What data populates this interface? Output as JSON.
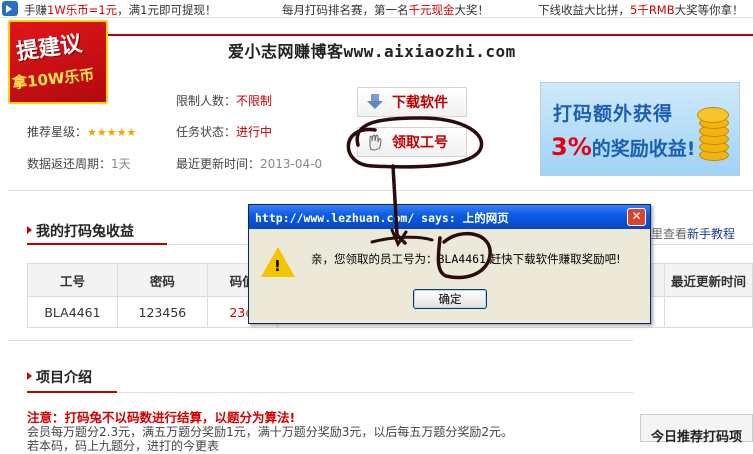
{
  "ticker": {
    "seg1_a": "手赚",
    "seg1_b": "1W乐币=1元",
    "seg1_c": "，满1元即可提现！",
    "seg2_a": "每月打码排名赛，第一名",
    "seg2_b": "千元现金",
    "seg2_c": "大奖！",
    "seg3_a": "下线收益大比拼，",
    "seg3_b": "5千RMB",
    "seg3_c": "大奖等你拿！"
  },
  "site_title": "爱小志网赚博客www.aixiaozhi.com",
  "badge": {
    "line1": "提建议",
    "line2": "拿10W乐币"
  },
  "info": {
    "limit_label": "限制人数：",
    "limit_value": "不限制",
    "rating_label": "推荐星级：",
    "stars": "★★★★★",
    "status_label": "任务状态：",
    "status_value": "进行中",
    "cycle_label": "数据返还周期：",
    "cycle_value": "1天",
    "updated_label": "最近更新时间：",
    "updated_value": "2013-04-0"
  },
  "buttons": {
    "download": "下载软件",
    "get_id": "领取工号"
  },
  "promo": {
    "line1": "打码额外获得",
    "pct": "3%",
    "line2": "的奖励收益!"
  },
  "earnings": {
    "title": "我的打码兔收益",
    "link_prefix": "里查看",
    "link": "新手教程"
  },
  "table": {
    "headers": [
      "工号",
      "密码",
      "码值",
      "",
      "最近更新时间"
    ],
    "row": [
      "BLA4461",
      "123456",
      "23",
      "",
      ""
    ]
  },
  "project": {
    "title": "项目介绍",
    "notice": "注意：打码兔不以码数进行结算，以题分为算法!",
    "body1": "会员每万题分2.3元，满五万题分奖励1元，满十万题分奖励3元，以后每五万题分奖励2元。",
    "body2": "若本码，码上九题分，进打的今更表"
  },
  "today": "今日推荐打码项",
  "dialog": {
    "title": "http://www.lezhuan.com/ says: 上的网页",
    "msg_pre": "亲，您领取的员工号为：",
    "msg_id": "BLA4461",
    "msg_post": "  赶快下载软件赚取奖励吧!",
    "ok": "确定"
  }
}
